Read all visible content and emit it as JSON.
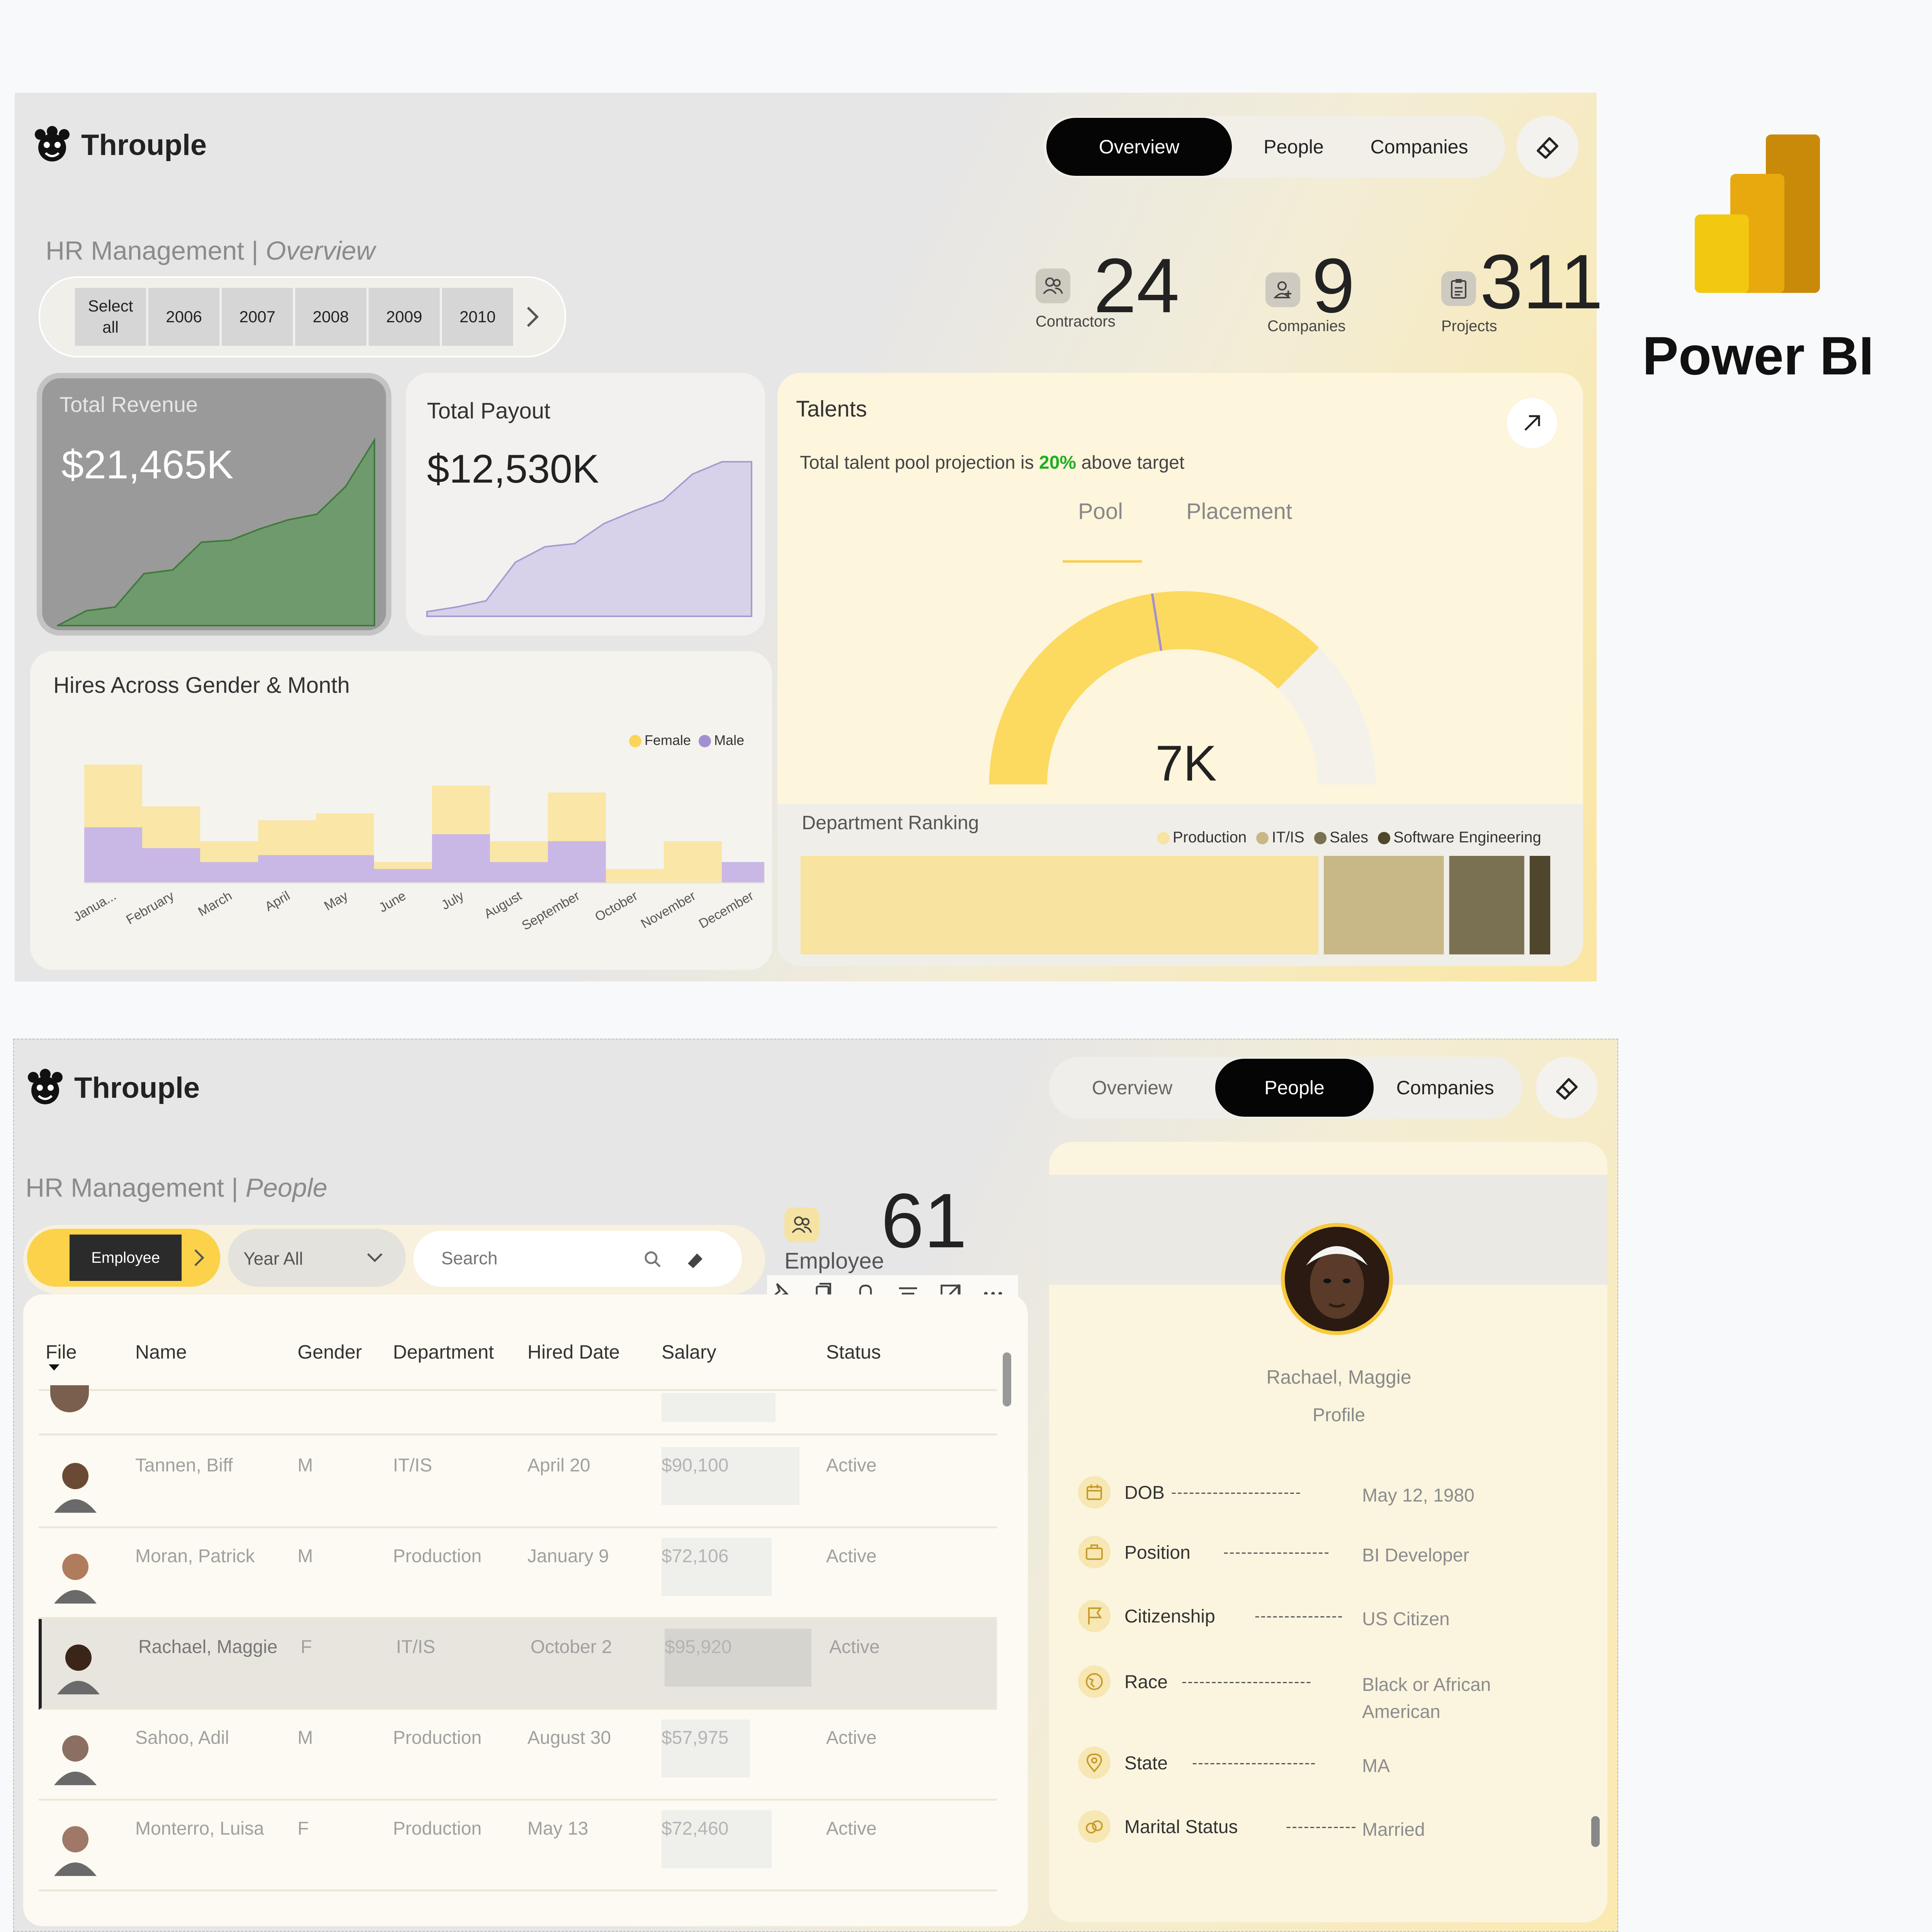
{
  "logo": {
    "label": "Power BI",
    "colors": [
      "#f2c811",
      "#e8a90f",
      "#c98a0a"
    ]
  },
  "overview": {
    "brand": "Throuple",
    "nav": {
      "overview": "Overview",
      "people": "People",
      "companies": "Companies",
      "active": "Overview"
    },
    "title_main": "HR Management | ",
    "title_sub": "Overview",
    "years": {
      "select_all_line1": "Select",
      "select_all_line2": "all",
      "list": [
        "2006",
        "2007",
        "2008",
        "2009",
        "2010"
      ]
    },
    "kpis": [
      {
        "value": "24",
        "label": "Contractors",
        "icon": "people-icon"
      },
      {
        "value": "9",
        "label": "Companies",
        "icon": "person-add-icon"
      },
      {
        "value": "311",
        "label": "Projects",
        "icon": "clipboard-icon"
      }
    ],
    "revenue": {
      "title": "Total Revenue",
      "value": "$21,465K"
    },
    "payout": {
      "title": "Total Payout",
      "value": "$12,530K"
    },
    "hires": {
      "title": "Hires Across Gender & Month",
      "legend_female": "Female",
      "legend_male": "Male"
    },
    "talents": {
      "title": "Talents",
      "projection_prefix": "Total talent pool projection is ",
      "projection_pct": "20%",
      "projection_suffix": " above target",
      "tab_pool": "Pool",
      "tab_placement": "Placement",
      "gauge_value": "7K"
    },
    "dept_ranking": {
      "title": "Department Ranking",
      "legend": [
        "Production",
        "IT/IS",
        "Sales",
        "Software Engineering"
      ]
    }
  },
  "people": {
    "brand": "Throuple",
    "nav": {
      "overview": "Overview",
      "people": "People",
      "companies": "Companies",
      "active": "People"
    },
    "title_main": "HR Management | ",
    "title_sub": "People",
    "filter_employee": "Employee",
    "filter_year": "Year All",
    "search_placeholder": "Search",
    "employee_count": "61",
    "employee_label": "Employee",
    "table": {
      "columns": [
        "File",
        "Name",
        "Gender",
        "Department",
        "Hired Date",
        "Salary",
        "Status"
      ],
      "rows": [
        {
          "name": "Tannen, Biff",
          "gender": "M",
          "dept": "IT/IS",
          "hired": "April 20",
          "salary": "$90,100",
          "salary_frac": 0.94,
          "status": "Active",
          "selected": false,
          "avatar": "#6b4a35"
        },
        {
          "name": "Moran, Patrick",
          "gender": "M",
          "dept": "Production",
          "hired": "January 9",
          "salary": "$72,106",
          "salary_frac": 0.75,
          "status": "Active",
          "selected": false,
          "avatar": "#b07c5e"
        },
        {
          "name": "Rachael, Maggie",
          "gender": "F",
          "dept": "IT/IS",
          "hired": "October 2",
          "salary": "$95,920",
          "salary_frac": 1.0,
          "status": "Active",
          "selected": true,
          "avatar": "#3b2418"
        },
        {
          "name": "Sahoo, Adil",
          "gender": "M",
          "dept": "Production",
          "hired": "August 30",
          "salary": "$57,975",
          "salary_frac": 0.6,
          "status": "Active",
          "selected": false,
          "avatar": "#8a6f62"
        },
        {
          "name": "Monterro, Luisa",
          "gender": "F",
          "dept": "Production",
          "hired": "May 13",
          "salary": "$72,460",
          "salary_frac": 0.75,
          "status": "Active",
          "selected": false,
          "avatar": "#a07868"
        }
      ]
    },
    "profile": {
      "name": "Rachael, Maggie",
      "subtitle": "Profile",
      "details": [
        {
          "label": "DOB",
          "dashes": "----------------------",
          "value": "May 12, 1980",
          "icon": "calendar-icon"
        },
        {
          "label": "Position",
          "dashes": "------------------",
          "value": "BI Developer",
          "icon": "briefcase-icon"
        },
        {
          "label": "Citizenship",
          "dashes": "---------------",
          "value": "US Citizen",
          "icon": "flag-icon"
        },
        {
          "label": "Race",
          "dashes": "----------------------",
          "value": "Black or African American",
          "icon": "globe-icon"
        },
        {
          "label": "State",
          "dashes": "---------------------",
          "value": "MA",
          "icon": "location-pin-icon"
        },
        {
          "label": "Marital Status",
          "dashes": "------------",
          "value": "Married",
          "icon": "rings-icon"
        }
      ]
    }
  },
  "chart_data": [
    {
      "type": "area",
      "title": "Total Revenue",
      "x": [
        1,
        2,
        3,
        4,
        5,
        6,
        7,
        8,
        9,
        10,
        11,
        12
      ],
      "series": [
        {
          "name": "",
          "values": [
            0,
            0.08,
            0.1,
            0.28,
            0.3,
            0.45,
            0.46,
            0.52,
            0.57,
            0.6,
            0.75,
            1.0
          ]
        }
      ],
      "color": "#6f9a6d"
    },
    {
      "type": "area",
      "title": "Total Payout",
      "x": [
        1,
        2,
        3,
        4,
        5,
        6,
        7,
        8,
        9,
        10,
        11,
        12
      ],
      "series": [
        {
          "name": "",
          "values": [
            0.03,
            0.06,
            0.1,
            0.35,
            0.45,
            0.47,
            0.6,
            0.68,
            0.75,
            0.92,
            1.0,
            1.0
          ]
        }
      ],
      "color": "#d8d1ea"
    },
    {
      "type": "bar",
      "stacked": true,
      "title": "Hires Across Gender & Month",
      "categories": [
        "Janua...",
        "February",
        "March",
        "April",
        "May",
        "June",
        "July",
        "August",
        "September",
        "October",
        "November",
        "December"
      ],
      "series": [
        {
          "name": "Male",
          "values": [
            8,
            5,
            3,
            4,
            4,
            2,
            7,
            3,
            6,
            0,
            0,
            3
          ],
          "color": "#c9b8e6"
        },
        {
          "name": "Female",
          "values": [
            9,
            6,
            3,
            5,
            6,
            1,
            7,
            3,
            7,
            2,
            6,
            0
          ],
          "color": "#fae6a6"
        }
      ],
      "legend": "top-right"
    },
    {
      "type": "pie",
      "title": "Talents",
      "gauge": true,
      "value_label": "7K",
      "values": [
        0.75,
        0.25
      ],
      "marker": 0.45,
      "colors": [
        "#fcd95f",
        "#f3f1ea"
      ]
    },
    {
      "type": "bar",
      "title": "Department Ranking",
      "orientation": "treemap",
      "categories": [
        "Production",
        "IT/IS",
        "Sales",
        "Software Engineering"
      ],
      "values": [
        69,
        16,
        10,
        3
      ],
      "colors": [
        "#f8e3a0",
        "#c8b887",
        "#7a7152",
        "#4f462c"
      ]
    }
  ]
}
